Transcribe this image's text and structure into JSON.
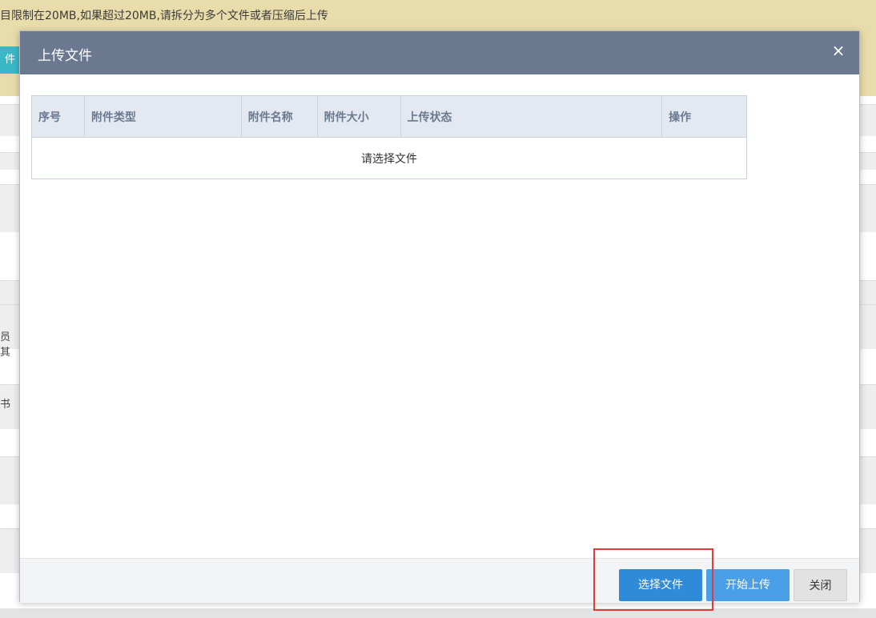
{
  "background": {
    "notice_text": "目限制在20MB,如果超过20MB,请拆分为多个文件或者压缩后上传",
    "tab_label": "件",
    "side_label_1": "员其",
    "side_label_2": "书"
  },
  "modal": {
    "title": "上传文件",
    "close_glyph": "×",
    "table": {
      "headers": [
        "序号",
        "附件类型",
        "附件名称",
        "附件大小",
        "上传状态",
        "操作"
      ],
      "empty_text": "请选择文件"
    },
    "footer": {
      "select_label": "选择文件",
      "upload_label": "开始上传",
      "close_label": "关闭"
    }
  },
  "colors": {
    "header_bg": "#6a7990",
    "primary_button": "#2f8ad8",
    "highlight": "#e33a3a",
    "notice_bg": "#e8dcaa"
  }
}
